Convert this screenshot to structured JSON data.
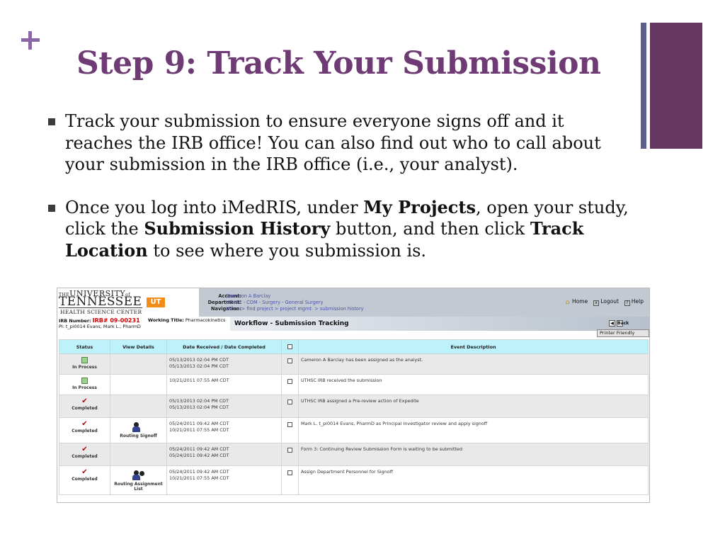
{
  "slide": {
    "title": "Step 9: Track Your Submission",
    "bullet1": "Track your submission to ensure everyone signs off and it reaches the IRB office!  You can also find out who to call about your submission in the IRB office (i.e., your analyst).",
    "bullet2": {
      "t1": "Once you log into iMedRIS, under ",
      "b1": "My Projects",
      "t2": ", open your study, click the ",
      "b2": "Submission History",
      "t3": " button, and then click ",
      "b3": "Track Location",
      "t4": " to see where you submission is."
    }
  },
  "app": {
    "logo": {
      "line1": "THE",
      "line1b": "UNIVERSITY",
      "line1c": "of",
      "line2": "TENNESSEE",
      "line3": "HEALTH SCIENCE CENTER",
      "badge": "UT"
    },
    "account": {
      "account_label": "Account:",
      "account_value": "Cameron A Barclay",
      "department_label": "Department:",
      "department_value": "UTHSC - COM - Surgery - General Surgery",
      "navigation_label": "Navigation:",
      "navigation_value": "Home > find project > project mgmt. > submission history"
    },
    "toplinks": {
      "home": "Home",
      "logout": "Logout",
      "help": "Help"
    },
    "irb_label": "IRB Number:",
    "irb_number": "IRB# 09-00231",
    "working_title_label": "Working Title:",
    "working_title": "Pharmacokinetics",
    "pi_line": "PI: t_pi0014 Evans, Mark L., PharmD",
    "workflow_title": "Workflow - Submission Tracking",
    "back_label": "Back",
    "printer_label": "Printer Friendly",
    "columns": [
      "Status",
      "View Details",
      "Date Received / Date Completed",
      "",
      "Event Description"
    ],
    "rows": [
      {
        "status": "In Process",
        "icon": "document-icon",
        "view": "",
        "received": "05/13/2013 02:04 PM CDT",
        "completed": "05/13/2013 02:04 PM CDT",
        "desc": "Cameron A Barclay has been assigned as the analyst."
      },
      {
        "status": "In Process",
        "icon": "document-icon",
        "view": "",
        "received": "10/21/2011 07:55 AM CDT",
        "completed": "",
        "desc": "UTHSC IRB received the submission"
      },
      {
        "status": "Completed",
        "icon": "check-icon",
        "view": "",
        "received": "05/13/2013 02:04 PM CDT",
        "completed": "05/13/2013 02:04 PM CDT",
        "desc": "UTHSC IRB assigned a Pre-review action of Expedite"
      },
      {
        "status": "Completed",
        "icon": "check-icon",
        "view": "Routing Signoff",
        "received": "05/24/2011 09:42 AM CDT",
        "completed": "10/21/2011 07:55 AM CDT",
        "desc": "Mark L. t_pi0014 Evans, PharmD as Principal Investigator review and apply signoff"
      },
      {
        "status": "Completed",
        "icon": "check-icon",
        "view": "",
        "received": "05/24/2011 09:42 AM CDT",
        "completed": "05/24/2011 09:42 AM CDT",
        "desc": "Form 3: Continuing Review Submission Form is waiting to be submitted"
      },
      {
        "status": "Completed",
        "icon": "check-icon",
        "view": "Routing Assignment List",
        "received": "05/24/2011 09:42 AM CDT",
        "completed": "10/21/2011 07:55 AM CDT",
        "desc": "Assign Department Personnel for Signoff"
      }
    ]
  }
}
